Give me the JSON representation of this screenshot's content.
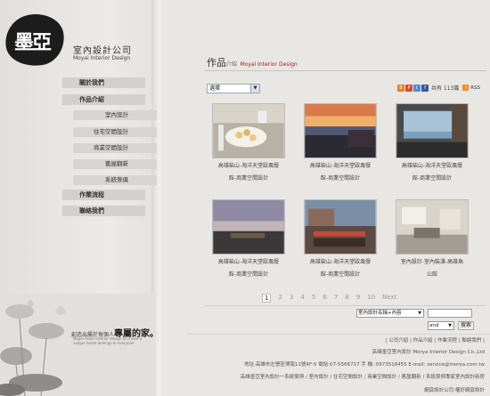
{
  "brand": {
    "logo_text": "墨亞",
    "name_cn": "室內設計公司",
    "name_en": "Moyai Interior Design"
  },
  "nav": {
    "items": [
      {
        "label": "關於我們"
      },
      {
        "label": "作品介紹"
      },
      {
        "label": "作業流程"
      },
      {
        "label": "聯絡我們"
      }
    ],
    "sub_items": [
      {
        "label": "室內設計"
      },
      {
        "label": "住宅空間設計"
      },
      {
        "label": "商業空間設計"
      },
      {
        "label": "舊屋翻新"
      },
      {
        "label": "系統傢俱"
      }
    ]
  },
  "slogan": {
    "prefix": "創造出屬於每個人",
    "emphasis": "專屬的家。",
    "en": "Moyai Asian interior design to create a unique home belongs to everyone"
  },
  "page": {
    "title": "作品",
    "title_sub": "介紹",
    "title_en": "Moyai Interior Design"
  },
  "filter": {
    "selected": "選擇"
  },
  "share": {
    "count_text": "共有 113篇",
    "rss_label": "RSS"
  },
  "works": [
    {
      "caption_line1": "高雄柴山-海洋天堂歐風餐",
      "caption_line2": "館-商業空間設計"
    },
    {
      "caption_line1": "高雄柴山-海洋天堂歐風餐",
      "caption_line2": "館-商業空間設計"
    },
    {
      "caption_line1": "高雄柴山-海洋天堂歐風餐",
      "caption_line2": "館-商業空間設計"
    },
    {
      "caption_line1": "高雄柴山-海洋天堂歐風餐",
      "caption_line2": "館-商業空間設計"
    },
    {
      "caption_line1": "高雄柴山-海洋天堂歐風餐",
      "caption_line2": "館-商業空間設計"
    },
    {
      "caption_line1": "室內設計-室內裝潢-高雄魚",
      "caption_line2": "公館"
    }
  ],
  "pagination": {
    "pages": [
      "1",
      "2",
      "3",
      "4",
      "5",
      "6",
      "7",
      "8",
      "9",
      "10"
    ],
    "current": "1",
    "next_label": "Next"
  },
  "search": {
    "field_select": "室內設計名稱+內容",
    "op_select": "and",
    "button_label": "搜索"
  },
  "footer": {
    "links": "| 公司介紹 | 作品介紹 | 作業流程 | 聯絡我們 |",
    "copyright": "高雄墨亞室內設計 Morya Interior Design Co.,Ltd",
    "address": "地址:高雄市左營區博南11號4F-5 電話:07-5566717 手 機: 0973516455 E-mail: service@morya.com.tw",
    "keywords": "高雄墨亞室內設計一系統傢俱 / 室內設計 / 住宅空間設計 / 商業空間設計 / 舊屋翻新 / 系統傢俱專家室內設計新房",
    "credit": "網頁設計公司:權好網頁設計"
  },
  "colors": {
    "accent": "#9b1b1b",
    "background": "#e9e7e3",
    "nav_bg": "#d3d1cd"
  }
}
